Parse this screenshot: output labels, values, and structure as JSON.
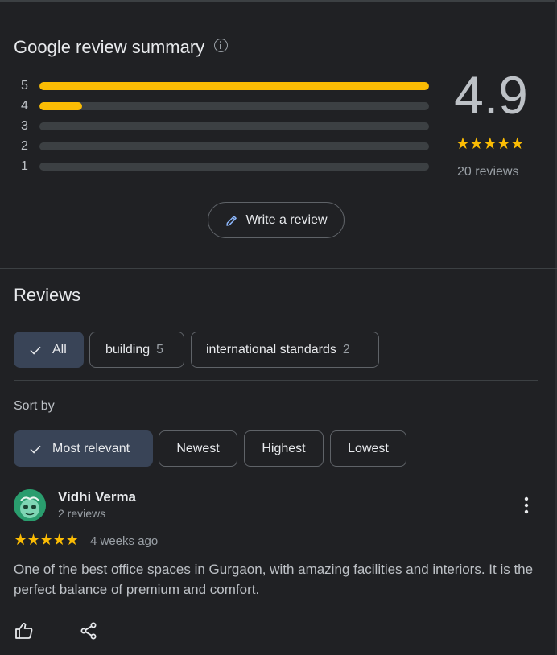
{
  "summary": {
    "title": "Google review summary",
    "distribution": [
      {
        "stars": "5",
        "fraction": 1.0
      },
      {
        "stars": "4",
        "fraction": 0.11
      },
      {
        "stars": "3",
        "fraction": 0.0
      },
      {
        "stars": "2",
        "fraction": 0.0
      },
      {
        "stars": "1",
        "fraction": 0.0
      }
    ],
    "rating": "4.9",
    "stars": "★★★★★",
    "review_count": "20 reviews",
    "write_label": "Write a review"
  },
  "reviews": {
    "title": "Reviews",
    "filters": [
      {
        "label": "All",
        "count": "",
        "selected": true
      },
      {
        "label": "building",
        "count": "5",
        "selected": false
      },
      {
        "label": "international standards",
        "count": "2",
        "selected": false
      }
    ],
    "sort_label": "Sort by",
    "sort_options": [
      {
        "label": "Most relevant",
        "selected": true
      },
      {
        "label": "Newest",
        "selected": false
      },
      {
        "label": "Highest",
        "selected": false
      },
      {
        "label": "Lowest",
        "selected": false
      }
    ],
    "items": [
      {
        "name": "Vidhi Verma",
        "sub": "2 reviews",
        "stars": "★★★★★",
        "time": "4 weeks ago",
        "text": "One of the best office spaces in Gurgaon, with amazing facilities and interiors. It is the perfect balance of premium and comfort."
      }
    ]
  },
  "colors": {
    "background": "#202124",
    "star": "#fbbc04",
    "selected_chip": "#394457",
    "pencil": "#8ab4f8"
  },
  "icons": [
    "info-icon",
    "pencil-icon",
    "check-icon",
    "more-vert-icon",
    "thumb-up-icon",
    "share-icon"
  ]
}
